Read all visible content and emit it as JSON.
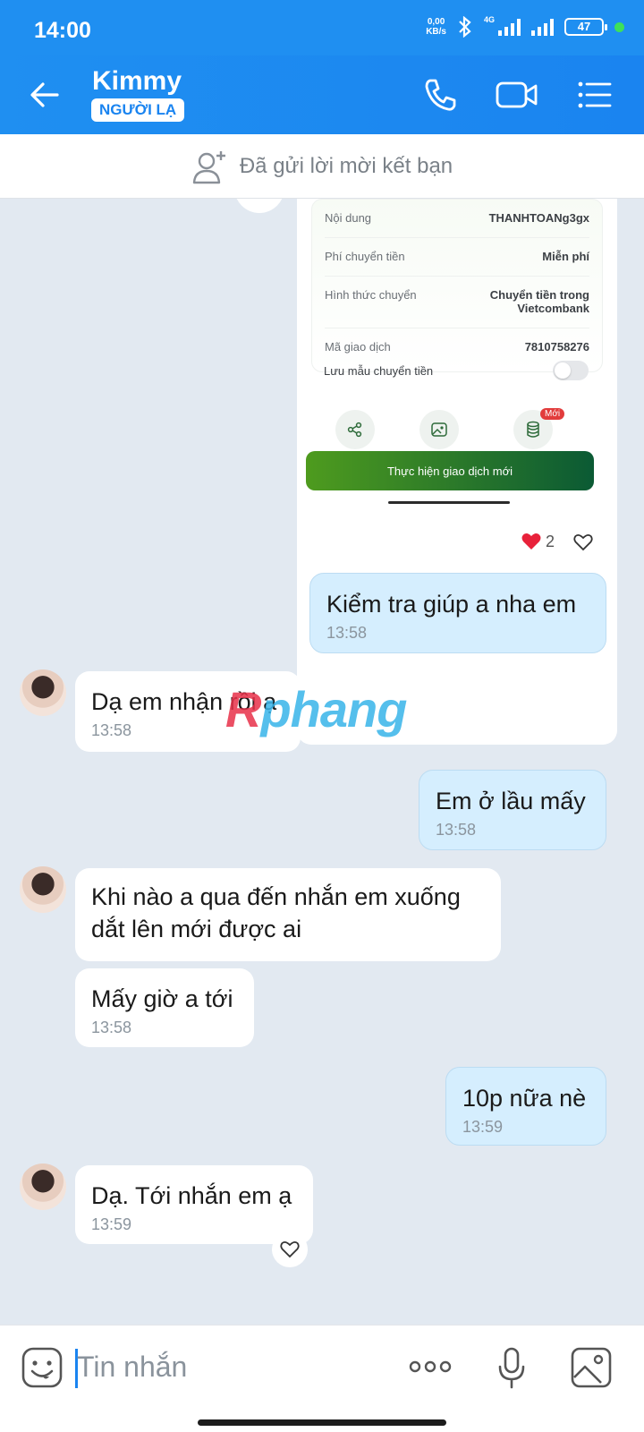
{
  "status_bar": {
    "time": "14:00",
    "net_speed_value": "0,00",
    "net_speed_unit": "KB/s",
    "network": "4G",
    "battery": "47"
  },
  "header": {
    "contact_name": "Kimmy",
    "badge": "NGƯỜI LẠ"
  },
  "friend_bar": {
    "text": "Đã gửi lời mời kết bạn"
  },
  "transfer_card": {
    "rows": [
      {
        "label": "Nội dung",
        "value": "THANHTOANg3gx"
      },
      {
        "label": "Phí chuyển tiền",
        "value": "Miễn phí"
      },
      {
        "label": "Hình thức chuyển",
        "value": "Chuyển tiền trong Vietcombank"
      },
      {
        "label": "Mã giao dịch",
        "value": "7810758276"
      }
    ],
    "save_template_label": "Lưu mẫu chuyển tiền",
    "new_tag": "Mới",
    "action_button": "Thực hiện giao dịch mới",
    "reaction_count": "2"
  },
  "messages": [
    {
      "side": "out",
      "text": "Kiểm tra giúp a nha em",
      "time": "13:58"
    },
    {
      "side": "in",
      "text": "Dạ em nhận rồi ạ",
      "time": "13:58"
    },
    {
      "side": "out",
      "text": "Em ở lầu mấy",
      "time": "13:58"
    },
    {
      "side": "in",
      "text": "Khi nào a qua đến nhắn em xuống dắt lên mới được ai",
      "time": ""
    },
    {
      "side": "in",
      "text": "Mấy giờ a tới",
      "time": "13:58"
    },
    {
      "side": "out",
      "text": "10p nữa nè",
      "time": "13:59"
    },
    {
      "side": "in",
      "text": "Dạ. Tới nhắn em ạ",
      "time": "13:59"
    }
  ],
  "watermark": {
    "part1": "R",
    "part2": "phang"
  },
  "input": {
    "placeholder": "Tin nhắn"
  },
  "icons": [
    "back-arrow-icon",
    "phone-icon",
    "video-call-icon",
    "menu-icon",
    "add-friend-icon",
    "share-icon",
    "image-icon",
    "coins-icon",
    "heart-icon",
    "emoji-icon",
    "more-icon",
    "microphone-icon",
    "gallery-icon"
  ],
  "colors": {
    "header_blue": "#1f8ff1",
    "outgoing_bubble": "#d5eefe",
    "chat_bg": "#e2e9f1",
    "vcb_green": "#4e9b1e"
  }
}
